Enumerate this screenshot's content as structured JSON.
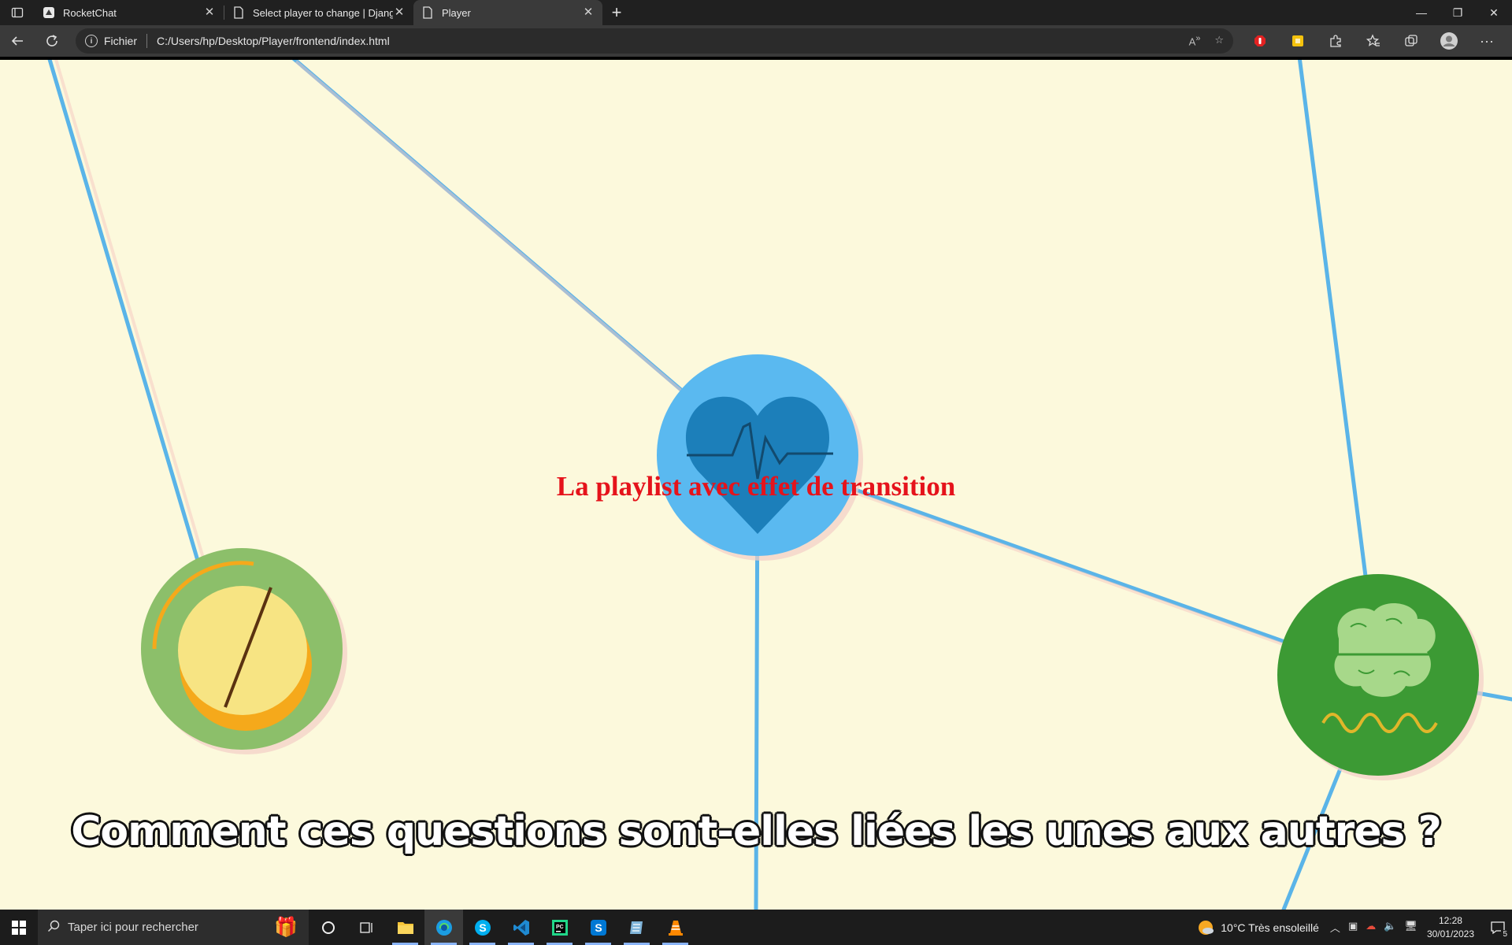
{
  "browser": {
    "tabs": [
      {
        "title": "RocketChat",
        "active": false
      },
      {
        "title": "Select player to change | Django",
        "active": false
      },
      {
        "title": "Player",
        "active": true
      }
    ],
    "new_tab": "+",
    "address": {
      "scheme_label": "Fichier",
      "url": "C:/Users/hp/Desktop/Player/frontend/index.html"
    }
  },
  "page": {
    "title": "La playlist avec effet de transition",
    "subtitle": "Comment ces questions sont-elles liées les unes aux autres ?",
    "colors": {
      "background": "#fcf9dc",
      "line": "#5ab4e8",
      "title": "#e5131b",
      "heart_node": "#5ab9f0",
      "pill_node": "#8cbf6a",
      "brain_node": "#3c9a34"
    },
    "nodes": [
      "heart-node",
      "pill-node",
      "brain-node"
    ]
  },
  "taskbar": {
    "search_placeholder": "Taper ici pour rechercher",
    "weather": "10°C  Très ensoleillé",
    "time": "12:28",
    "date": "30/01/2023",
    "notification_count": "5"
  }
}
